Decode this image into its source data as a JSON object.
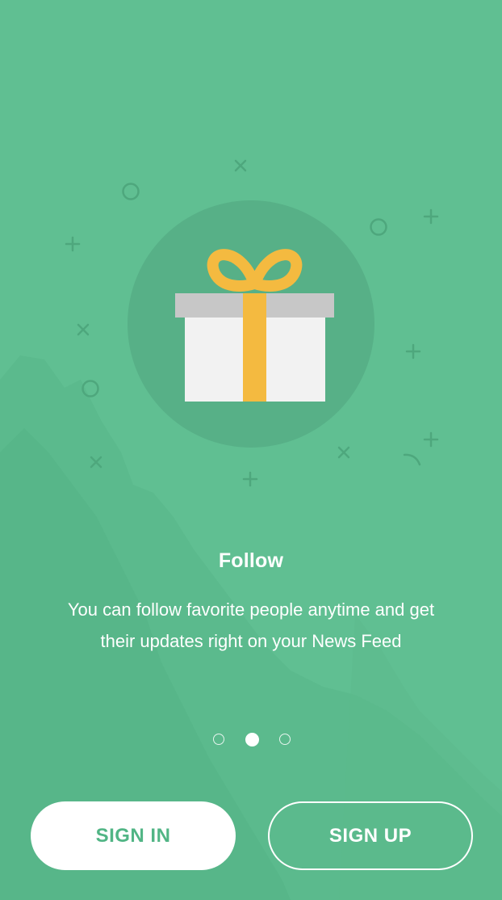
{
  "onboarding": {
    "title": "Follow",
    "description": "You can follow favorite people anytime and get their updates right on your News Feed",
    "current_page": 2,
    "total_pages": 3,
    "illustration_icon": "gift-icon"
  },
  "actions": {
    "sign_in_label": "SIGN IN",
    "sign_up_label": "SIGN UP"
  },
  "colors": {
    "background": "#60bf92",
    "circle": "#57b087",
    "gift_box": "#f2f2f2",
    "gift_lid": "#c7c7c7",
    "ribbon": "#f4ba40",
    "button_text": "#51b585"
  }
}
